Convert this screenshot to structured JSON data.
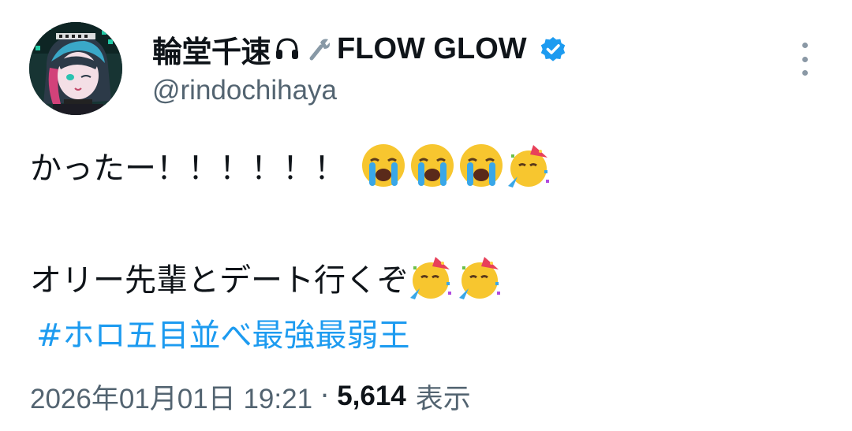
{
  "author": {
    "display_name": "輪堂千速",
    "display_suffix": "FLOW GLOW",
    "name_icons": [
      "headphones-icon",
      "wrench-icon"
    ],
    "verified": true,
    "handle": "@rindochihaya",
    "avatar": "avatar-image"
  },
  "tweet": {
    "line1_text": "かったー！！！！！！",
    "line1_emojis": [
      "loudly-crying-face-emoji",
      "loudly-crying-face-emoji",
      "loudly-crying-face-emoji",
      "partying-face-emoji"
    ],
    "line2_text": "オリー先輩とデート行くぞ",
    "line2_emojis": [
      "partying-face-emoji",
      "partying-face-emoji"
    ],
    "hashtag": "#ホロ五目並べ最強最弱王"
  },
  "meta": {
    "timestamp": "2026年01月01日 19:21",
    "separator": "·",
    "view_count": "5,614",
    "views_label": "表示"
  },
  "colors": {
    "text": "#0f1419",
    "secondary": "#536471",
    "link": "#1d9bf0",
    "verified": "#1d9bf0"
  }
}
